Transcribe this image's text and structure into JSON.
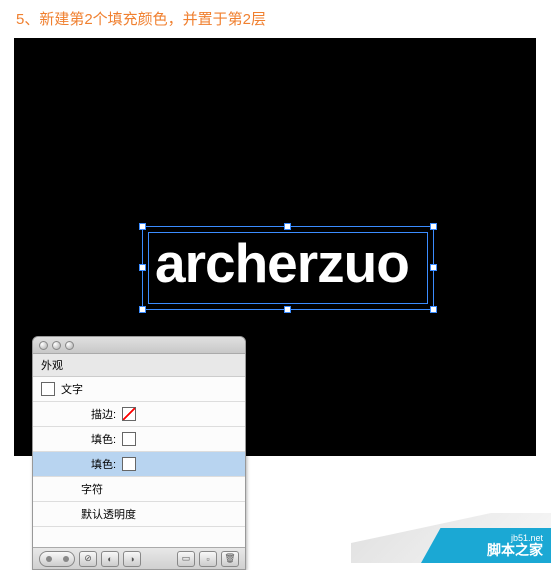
{
  "caption": "5、新建第2个填充颜色，并置于第2层",
  "canvas_text": "archerzuo",
  "panel": {
    "tab": "外观",
    "row_text": "文字",
    "row_stroke": "描边:",
    "row_fill1": "填色:",
    "row_fill2": "填色:",
    "row_char": "字符",
    "row_opacity": "默认透明度"
  },
  "watermark": {
    "url": "jb51.net",
    "name": "脚本之家"
  }
}
